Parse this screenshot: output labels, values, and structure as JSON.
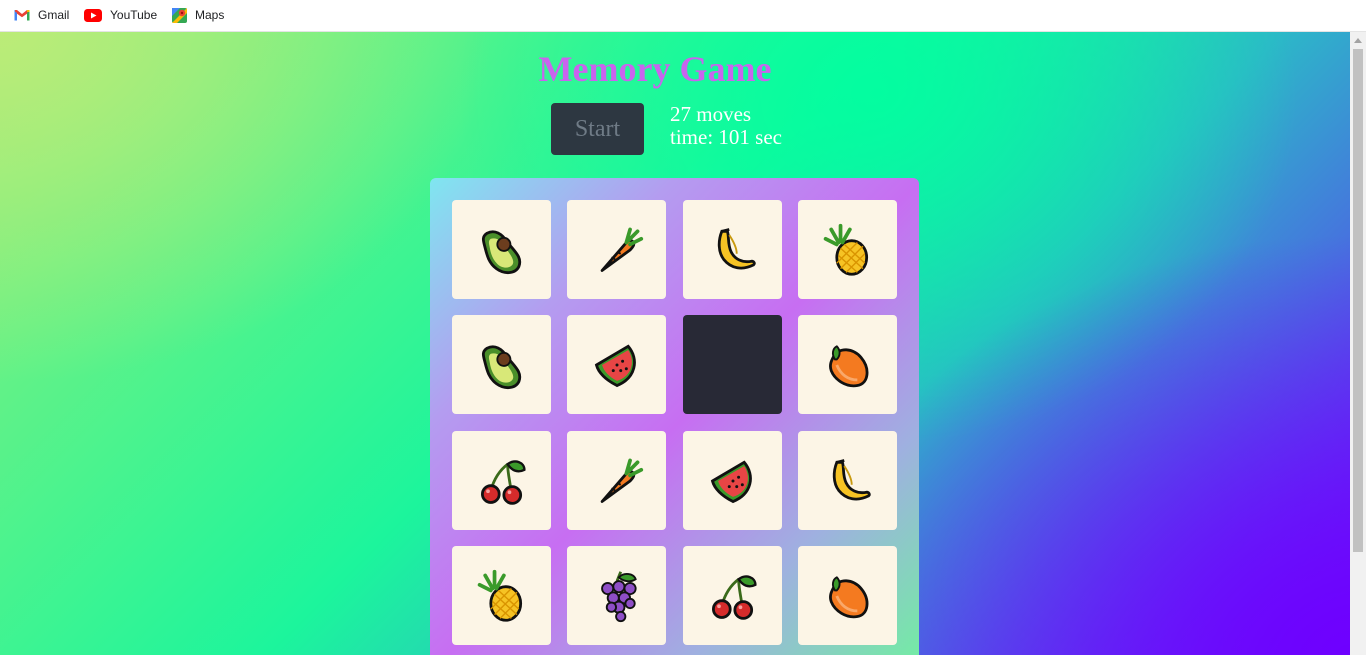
{
  "bookmarks": [
    {
      "label": "Gmail",
      "icon": "gmail-icon"
    },
    {
      "label": "YouTube",
      "icon": "youtube-icon"
    },
    {
      "label": "Maps",
      "icon": "maps-icon"
    }
  ],
  "game": {
    "title": "Memory Game",
    "start_label": "Start",
    "moves_text": "27 moves",
    "time_text": "time: 101 sec"
  },
  "cards": [
    "avocado",
    "carrot",
    "banana",
    "pineapple",
    "avocado",
    "watermelon",
    "hidden",
    "mango",
    "cherries",
    "carrot",
    "watermelon",
    "banana",
    "pineapple",
    "grapes",
    "cherries",
    "mango"
  ],
  "colors": {
    "title": "#c964ee",
    "card_face": "#fcf5e6",
    "card_back": "#282936",
    "start_button": "#2d3741"
  }
}
